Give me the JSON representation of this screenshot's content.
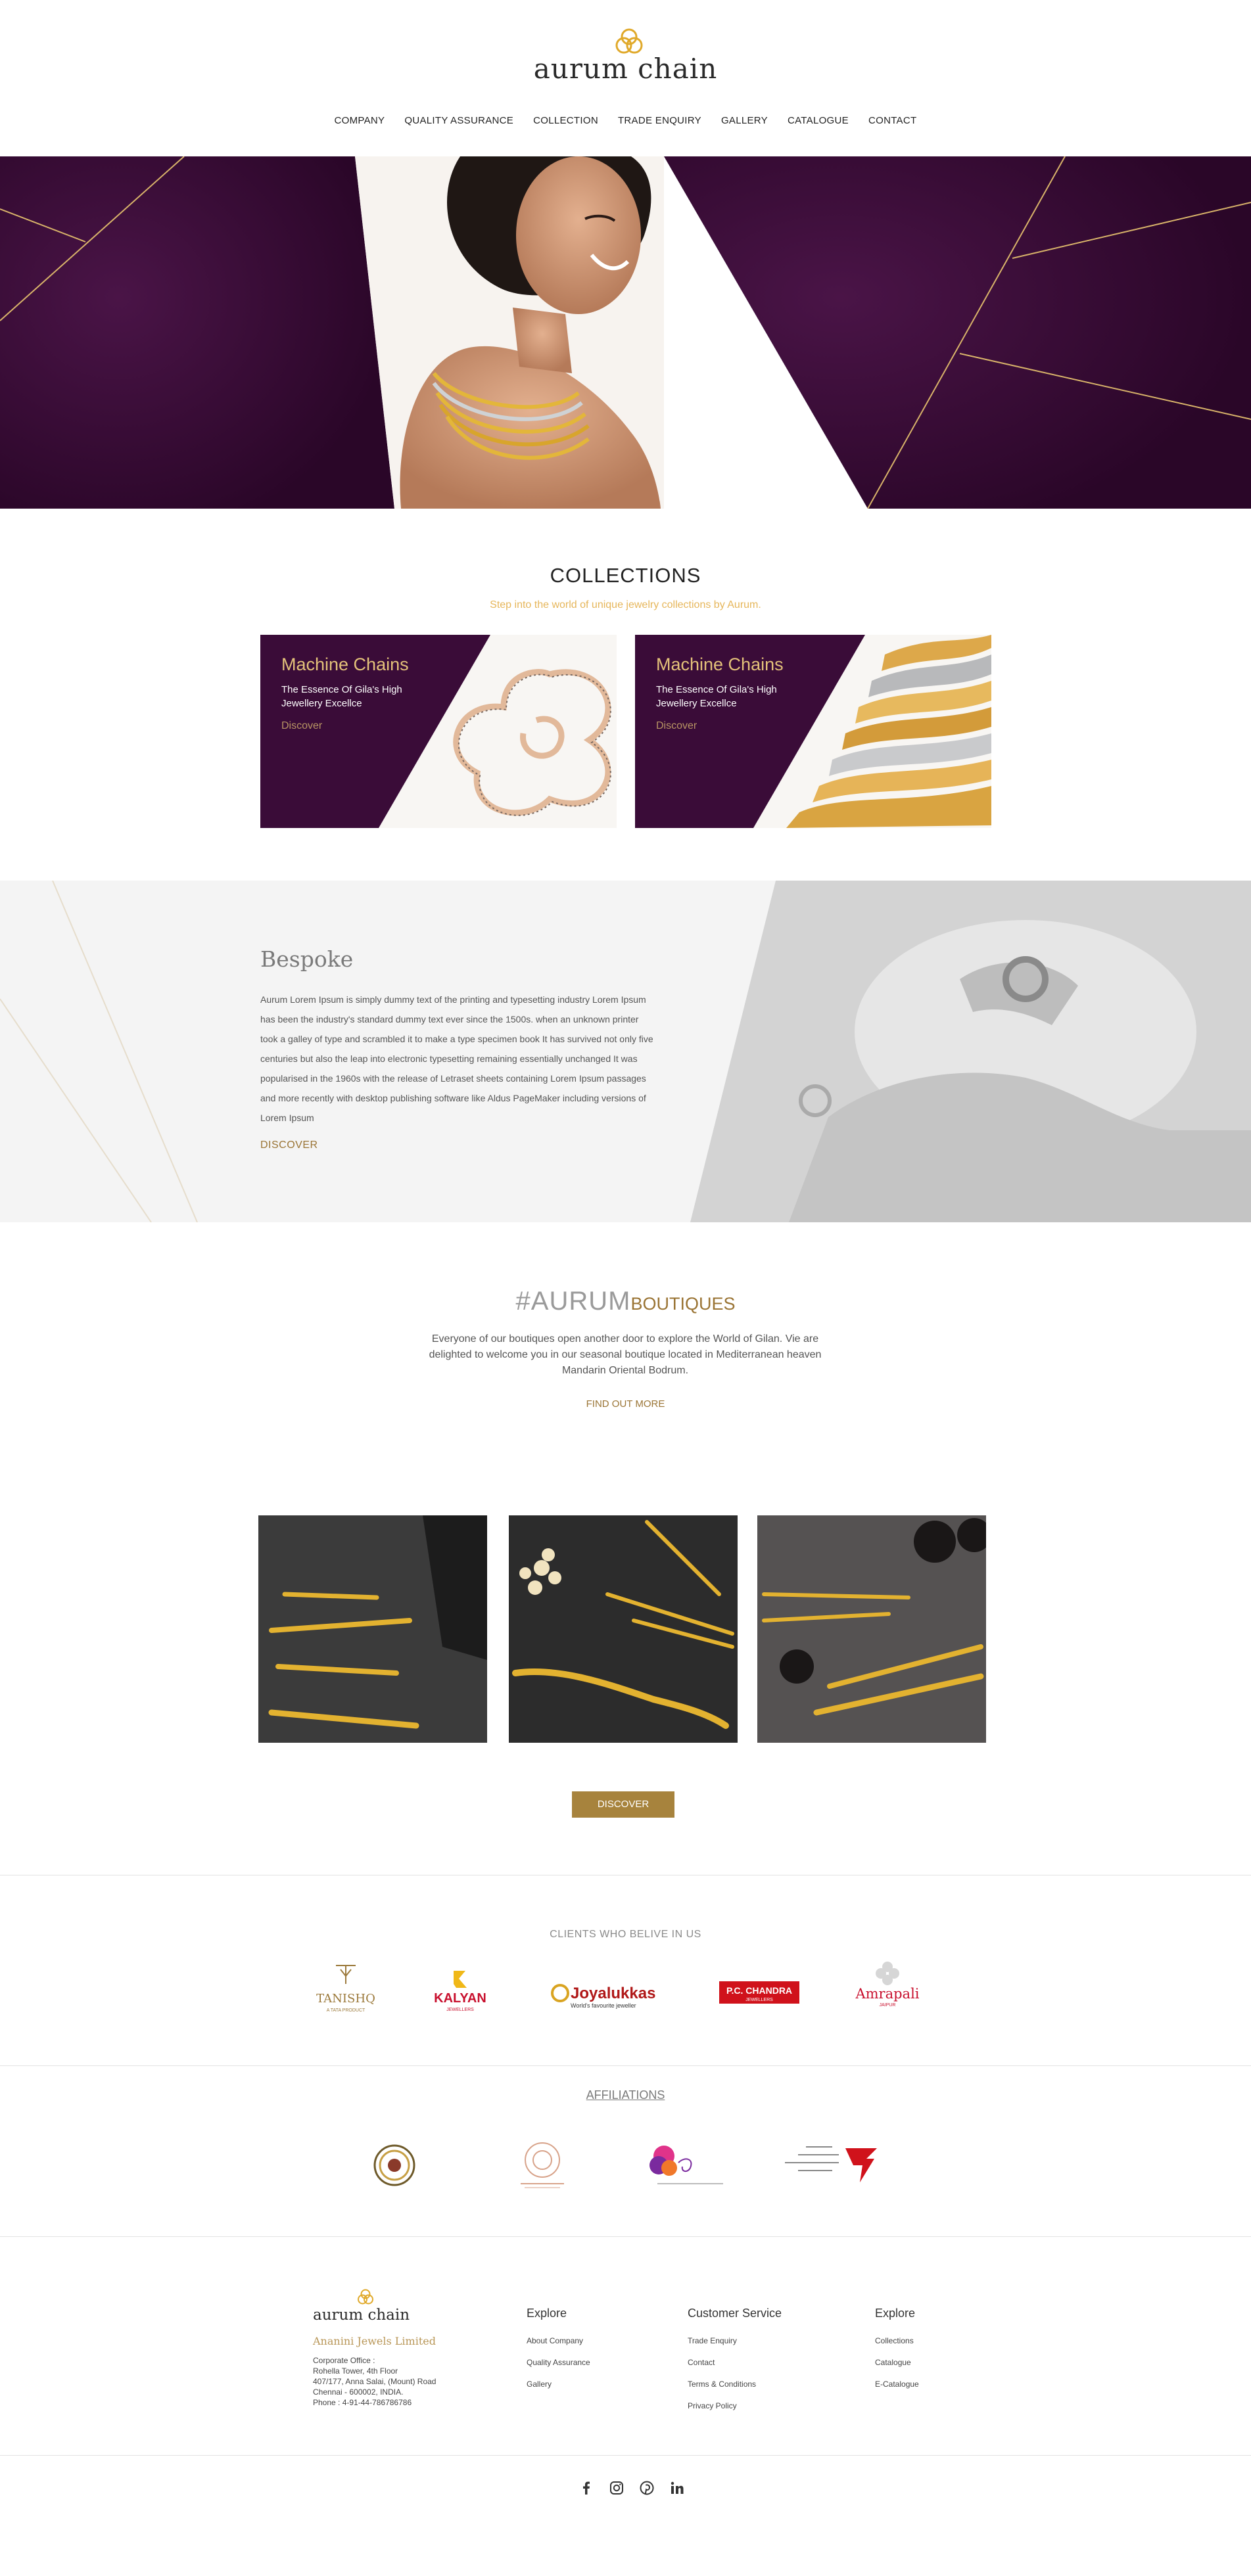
{
  "header": {
    "logo_text": "aurum chain",
    "nav": [
      "COMPANY",
      "QUALITY ASSURANCE",
      "COLLECTION",
      "TRADE ENQUIRY",
      "GALLERY",
      "CATALOGUE",
      "CONTACT"
    ]
  },
  "collections": {
    "title": "COLLECTIONS",
    "subtitle": "Step into the world of unique jewelry collections by Aurum.",
    "cards": [
      {
        "title": "Machine Chains",
        "description": "The Essence Of Gila's High Jewellery Excellce",
        "link": "Discover"
      },
      {
        "title": "Machine Chains",
        "description": "The Essence Of Gila's High Jewellery Excellce",
        "link": "Discover"
      }
    ]
  },
  "bespoke": {
    "title": "Bespoke",
    "text": "Aurum Lorem Ipsum is simply dummy text of the printing and typesetting industry Lorem Ipsum has been the industry's standard dummy text ever since the 1500s. when an unknown printer took a galley of type and scrambled it to make a type specimen book It has survived not only five centuries but also the leap into electronic typesetting remaining essentially unchanged It was popularised in the 1960s with the release of Letraset sheets containing Lorem Ipsum passages and more recently with desktop publishing software like Aldus PageMaker including versions of Lorem Ipsum",
    "link": "DISCOVER"
  },
  "boutiques": {
    "hashtag": "#AURUM",
    "title": "BOUTIQUES",
    "text": "Everyone of our boutiques open another door to explore the World of Gilan. Vie are delighted to welcome you in our seasonal boutique located in Mediterranean heaven Mandarin Oriental Bodrum.",
    "link": "FIND OUT MORE",
    "button": "DISCOVER"
  },
  "clients": {
    "title": "CLIENTS WHO BELIVE IN US",
    "logos": [
      {
        "name": "TANISHQ",
        "sub": "A TATA PRODUCT",
        "color": "#9c7a3c"
      },
      {
        "name": "KALYAN",
        "sub": "JEWELLERS",
        "color": "#c8102e"
      },
      {
        "name": "Joyalukkas",
        "sub": "World's favourite jeweller",
        "color": "#b01818"
      },
      {
        "name": "P.C. CHANDRA",
        "sub": "JEWELLERS",
        "color": "#d0121b"
      },
      {
        "name": "Amrapali",
        "sub": "JAIPUR",
        "color": "#c8102e"
      }
    ]
  },
  "affiliations": {
    "title": "AFFILIATIONS"
  },
  "footer": {
    "logo_text": "aurum chain",
    "company": "Ananini Jewels Limited",
    "address": [
      "Corporate Office :",
      "Rohella Tower, 4th Floor",
      "407/177, Anna Salai, (Mount) Road",
      "Chennai - 600002, INDIA.",
      "Phone : 4-91-44-786786786"
    ],
    "columns": [
      {
        "title": "Explore",
        "links": [
          "About Company",
          "Quality Assurance",
          "Gallery"
        ]
      },
      {
        "title": "Customer Service",
        "links": [
          "Trade Enquiry",
          "Contact",
          "Terms & Conditions",
          "Privacy Policy"
        ]
      },
      {
        "title": "Explore",
        "links": [
          "Collections",
          "Catalogue",
          "E-Catalogue"
        ]
      }
    ],
    "social": [
      "facebook-icon",
      "instagram-icon",
      "pinterest-icon",
      "linkedin-icon"
    ]
  },
  "colors": {
    "purple": "#3a0c38",
    "gold": "#a7833d",
    "accent": "#e6b65a"
  }
}
